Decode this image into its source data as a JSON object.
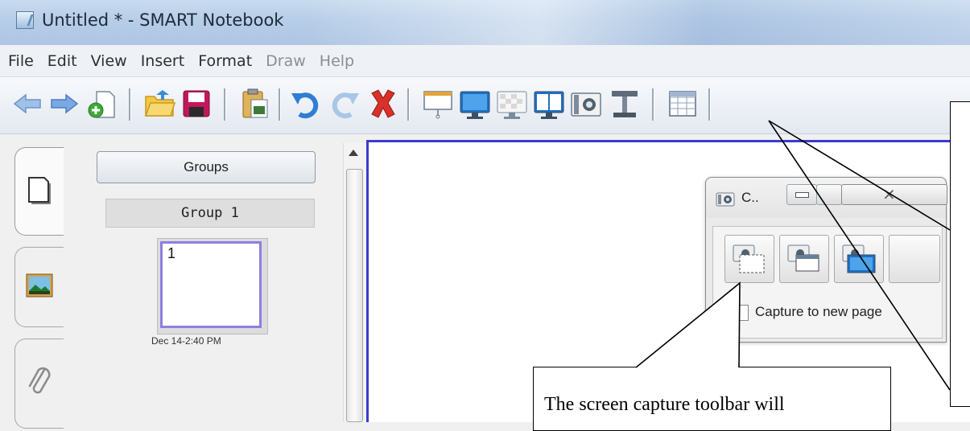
{
  "window": {
    "title": "Untitled * - SMART Notebook"
  },
  "menu": {
    "items": [
      {
        "label": "File"
      },
      {
        "label": "Edit"
      },
      {
        "label": "View"
      },
      {
        "label": "Insert"
      },
      {
        "label": "Format"
      },
      {
        "label": "Draw"
      },
      {
        "label": "Help"
      }
    ]
  },
  "toolbar": {
    "icons": [
      "back-arrow-icon",
      "forward-arrow-icon",
      "add-page-icon",
      "open-folder-icon",
      "save-disk-icon",
      "paste-icon",
      "undo-icon",
      "redo-icon",
      "delete-x-icon",
      "screen-shade-icon",
      "full-screen-icon",
      "transparent-background-icon",
      "dual-page-icon",
      "screen-capture-icon",
      "document-camera-icon",
      "table-icon"
    ]
  },
  "sidebar": {
    "groups_button": "Groups",
    "group_label": "Group 1",
    "page_number": "1",
    "page_date": "Dec 14-2:40 PM"
  },
  "capture_toolbar": {
    "title": "C..",
    "close_label": "⨯",
    "checkbox_label": "Capture to new page"
  },
  "callout": {
    "text": "The screen capture toolbar will"
  },
  "colors": {
    "canvas_border": "#3b3bd0",
    "page_highlight": "#8f7fe0",
    "delete_red": "#d9312a"
  }
}
